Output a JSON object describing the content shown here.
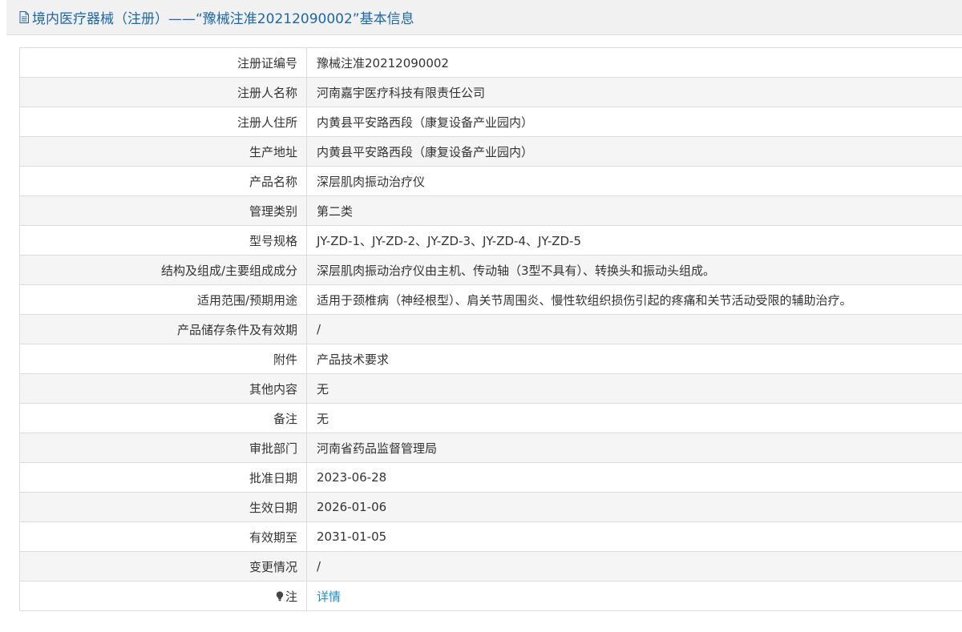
{
  "header": {
    "icon": "document-icon",
    "title": "境内医疗器械（注册）——“豫械注准20212090002”基本信息",
    "color": "#1a67b1"
  },
  "rows": [
    {
      "label": "注册证编号",
      "value": "豫械注准20212090002"
    },
    {
      "label": "注册人名称",
      "value": "河南嘉宇医疗科技有限责任公司"
    },
    {
      "label": "注册人住所",
      "value": "内黄县平安路西段（康复设备产业园内）"
    },
    {
      "label": "生产地址",
      "value": "内黄县平安路西段（康复设备产业园内）"
    },
    {
      "label": "产品名称",
      "value": "深层肌肉振动治疗仪"
    },
    {
      "label": "管理类别",
      "value": "第二类"
    },
    {
      "label": "型号规格",
      "value": "JY-ZD-1、JY-ZD-2、JY-ZD-3、JY-ZD-4、JY-ZD-5"
    },
    {
      "label": "结构及组成/主要组成成分",
      "value": "深层肌肉振动治疗仪由主机、传动轴（3型不具有）、转换头和振动头组成。"
    },
    {
      "label": "适用范围/预期用途",
      "value": "适用于颈椎病（神经根型）、肩关节周围炎、慢性软组织损伤引起的疼痛和关节活动受限的辅助治疗。"
    },
    {
      "label": "产品储存条件及有效期",
      "value": "/"
    },
    {
      "label": "附件",
      "value": "产品技术要求"
    },
    {
      "label": "其他内容",
      "value": "无"
    },
    {
      "label": "备注",
      "value": "无"
    },
    {
      "label": "审批部门",
      "value": "河南省药品监督管理局"
    },
    {
      "label": "批准日期",
      "value": "2023-06-28"
    },
    {
      "label": "生效日期",
      "value": "2026-01-06"
    },
    {
      "label": "有效期至",
      "value": "2031-01-05"
    },
    {
      "label": "变更情况",
      "value": "/"
    }
  ],
  "note": {
    "icon": "bulb-icon",
    "label": "注",
    "link": "详情",
    "link_color": "#1a8fd6"
  }
}
